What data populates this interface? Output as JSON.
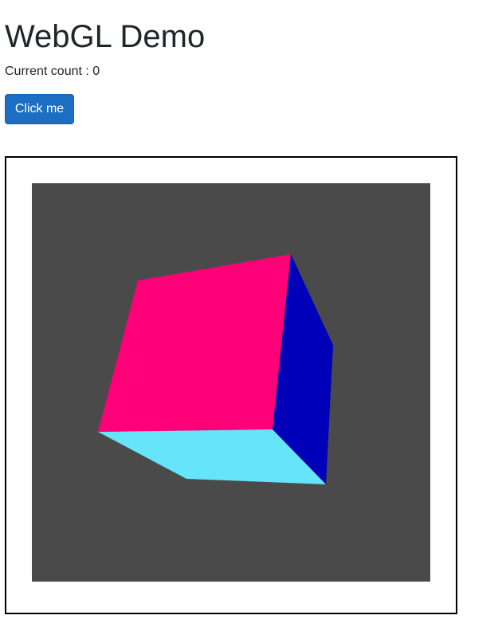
{
  "page": {
    "title": "WebGL Demo",
    "count_label": "Current count",
    "count_separator": ":",
    "count_value": "0"
  },
  "button": {
    "label": "Click me"
  },
  "canvas": {
    "background_color": "#4a4a4a",
    "cube": {
      "front_face_color": "#ff0078",
      "right_face_color": "#0000b8",
      "bottom_face_color": "#66e4fa"
    }
  },
  "colors": {
    "button_bg": "#1b6ec2",
    "text": "#212529"
  }
}
